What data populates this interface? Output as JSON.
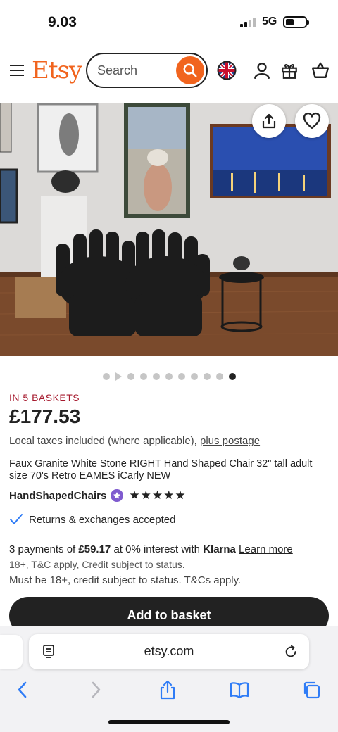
{
  "status": {
    "time": "9.03",
    "network": "5G"
  },
  "header": {
    "logo": "Etsy",
    "search_placeholder": "Search"
  },
  "icons": {
    "menu": "menu-icon",
    "search": "search-icon",
    "region": "uk-flag-icon",
    "account": "user-icon",
    "gift": "gift-icon",
    "basket": "basket-icon",
    "share": "share-icon",
    "favorite": "heart-icon"
  },
  "carousel": {
    "total_dots": 11,
    "active_index": 10,
    "video_index": 1
  },
  "listing": {
    "baskets": "IN 5 BASKETS",
    "price": "£177.53",
    "taxes_text": "Local taxes included (where applicable),",
    "postage_link": "plus postage",
    "title": "Faux Granite White Stone RIGHT Hand Shaped Chair 32\" tall adult size 70's Retro EAMES iCarly NEW",
    "shop_name": "HandShapedChairs",
    "rating_stars": "★★★★★",
    "rating": 5,
    "returns": "Returns & exchanges accepted",
    "klarna_prefix": "3 payments of",
    "klarna_amount": "£59.17",
    "klarna_mid": "at 0% interest with",
    "klarna_brand": "Klarna",
    "klarna_link": "Learn more",
    "klarna_terms": "18+, T&C apply, Credit subject to status.",
    "age_note": "Must be 18+, credit subject to status. T&Cs apply.",
    "add_to_basket": "Add to basket"
  },
  "safari": {
    "url": "etsy.com"
  },
  "colors": {
    "accent": "#f1641e",
    "baskets": "#a61a2e",
    "button": "#222222",
    "star_seller": "#7f5bcf",
    "safari_blue": "#2f7cf6"
  }
}
